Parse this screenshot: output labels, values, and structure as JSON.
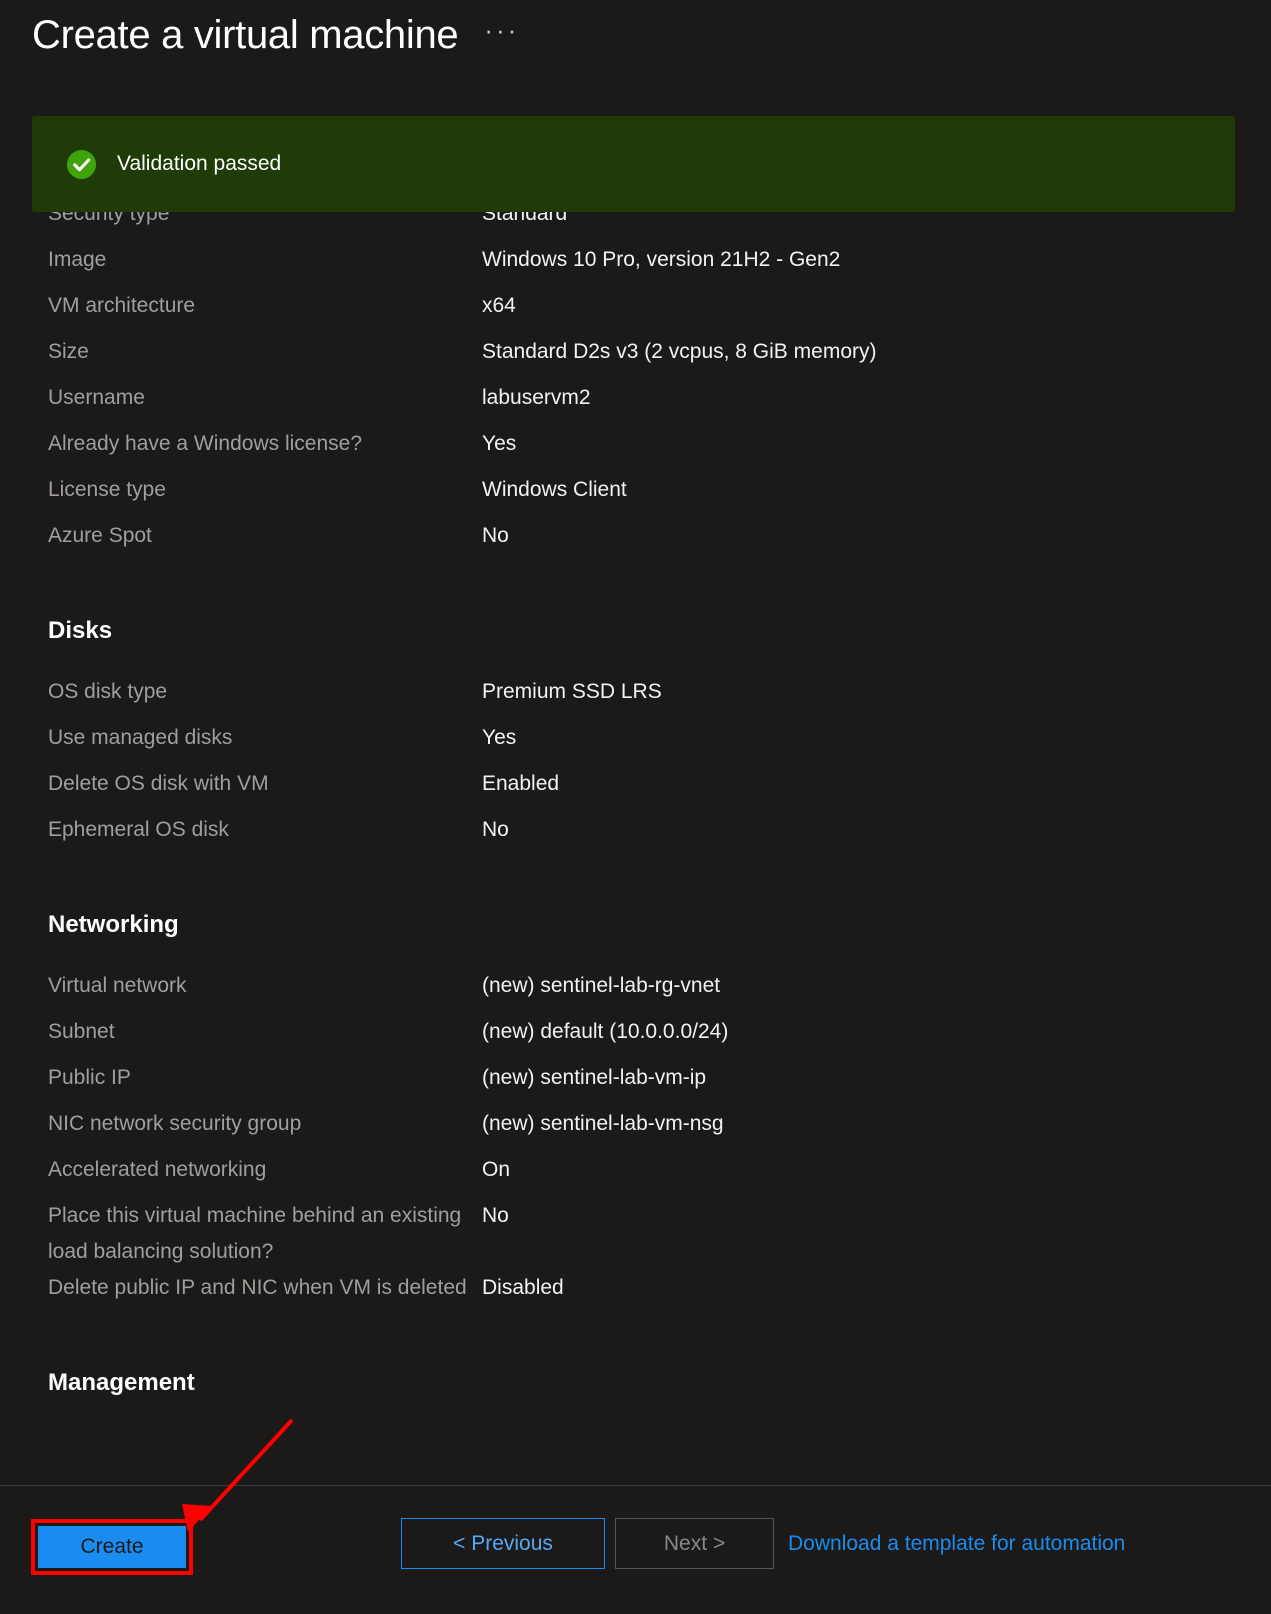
{
  "header": {
    "title": "Create a virtual machine",
    "ellipsis": "···"
  },
  "banner": {
    "icon": "check-circle-icon",
    "text": "Validation passed",
    "background_color": "#1f3b07",
    "icon_color": "#3fa40b"
  },
  "summary": {
    "rows_top": [
      {
        "label": "Security type",
        "value": "Standard"
      },
      {
        "label": "Image",
        "value": "Windows 10 Pro, version 21H2 - Gen2"
      },
      {
        "label": "VM architecture",
        "value": "x64"
      },
      {
        "label": "Size",
        "value": "Standard D2s v3 (2 vcpus, 8 GiB memory)"
      },
      {
        "label": "Username",
        "value": "labuservm2"
      },
      {
        "label": "Already have a Windows license?",
        "value": "Yes"
      },
      {
        "label": "License type",
        "value": "Windows Client"
      },
      {
        "label": "Azure Spot",
        "value": "No"
      }
    ],
    "sections": [
      {
        "heading": "Disks",
        "rows": [
          {
            "label": "OS disk type",
            "value": "Premium SSD LRS"
          },
          {
            "label": "Use managed disks",
            "value": "Yes"
          },
          {
            "label": "Delete OS disk with VM",
            "value": "Enabled"
          },
          {
            "label": "Ephemeral OS disk",
            "value": "No"
          }
        ]
      },
      {
        "heading": "Networking",
        "rows": [
          {
            "label": "Virtual network",
            "value": "(new) sentinel-lab-rg-vnet"
          },
          {
            "label": "Subnet",
            "value": "(new) default (10.0.0.0/24)"
          },
          {
            "label": "Public IP",
            "value": "(new) sentinel-lab-vm-ip"
          },
          {
            "label": "NIC network security group",
            "value": "(new) sentinel-lab-vm-nsg"
          },
          {
            "label": "Accelerated networking",
            "value": "On"
          },
          {
            "label": "Place this virtual machine behind an existing load balancing solution?",
            "value": "No"
          },
          {
            "label": "Delete public IP and NIC when VM is deleted",
            "value": "Disabled"
          }
        ]
      },
      {
        "heading": "Management",
        "rows": []
      }
    ]
  },
  "footer": {
    "create_label": "Create",
    "previous_label": "< Previous",
    "next_label": "Next >",
    "download_template_label": "Download a template for automation",
    "accent_color": "#1a8cf0",
    "annotation_color": "#ff0000"
  }
}
